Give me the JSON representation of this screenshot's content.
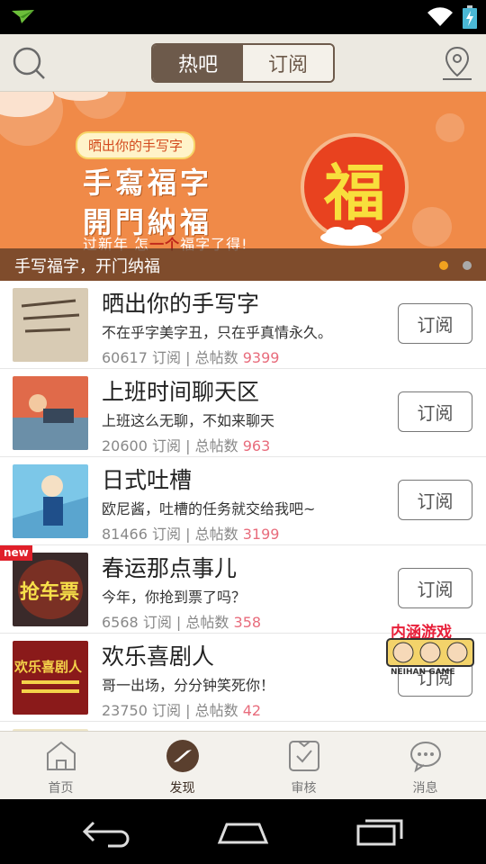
{
  "status_bar": {
    "icons": [
      "app-notification-icon",
      "wifi-icon",
      "battery-charging-icon"
    ]
  },
  "top_bar": {
    "search_icon": "search-icon",
    "location_icon": "location-pin-icon",
    "tabs": [
      {
        "label": "热吧",
        "active": true
      },
      {
        "label": "订阅",
        "active": false
      }
    ]
  },
  "banner": {
    "tag": "晒出你的手写字",
    "headline1": "手寫福字",
    "headline2": "開門納福",
    "subline_pre": "过新年 怎",
    "subline_hl": "一个",
    "subline_post": "福字了得!",
    "fu": "福",
    "caption": "手写福字，开门纳福",
    "dots": 2,
    "active_dot": 0,
    "colors": {
      "background": "#f08a48",
      "fu_circle": "#e8421f",
      "fu_text": "#f8df3c",
      "dot_active": "#f2a21f",
      "dot_inactive": "#aaaaaa"
    }
  },
  "subscribe_label": "订阅",
  "stats_labels": {
    "subs": "订阅",
    "sep": "|",
    "posts": "总帖数"
  },
  "list": [
    {
      "title": "晒出你的手写字",
      "desc": "不在乎字美字丑，只在乎真情永久。",
      "subs": "60617",
      "posts": "9399",
      "badge": ""
    },
    {
      "title": "上班时间聊天区",
      "desc": "上班这么无聊，不如来聊天",
      "subs": "20600",
      "posts": "963",
      "badge": ""
    },
    {
      "title": "日式吐槽",
      "desc": "欧尼酱，吐槽的任务就交给我吧~",
      "subs": "81466",
      "posts": "3199",
      "badge": ""
    },
    {
      "title": "春运那点事儿",
      "desc": "今年，你抢到票了吗？",
      "subs": "6568",
      "posts": "358",
      "badge": "new"
    },
    {
      "title": "欢乐喜剧人",
      "desc": "哥一出场，分分钟笑死你！",
      "subs": "23750",
      "posts": "42",
      "badge": ""
    }
  ],
  "thumb_texts": {
    "t4": "抢车票",
    "t5": "欢乐喜剧人"
  },
  "floating_game": {
    "title": "内涵游戏",
    "subtitle": "NEIHAN GAME"
  },
  "bottom_nav": [
    {
      "label": "首页",
      "icon": "home-icon",
      "active": false
    },
    {
      "label": "发现",
      "icon": "compass-icon",
      "active": true
    },
    {
      "label": "审核",
      "icon": "review-check-icon",
      "active": false
    },
    {
      "label": "消息",
      "icon": "chat-bubble-icon",
      "active": false
    }
  ],
  "system_nav": [
    "back-icon",
    "home-button-icon",
    "recents-icon"
  ]
}
